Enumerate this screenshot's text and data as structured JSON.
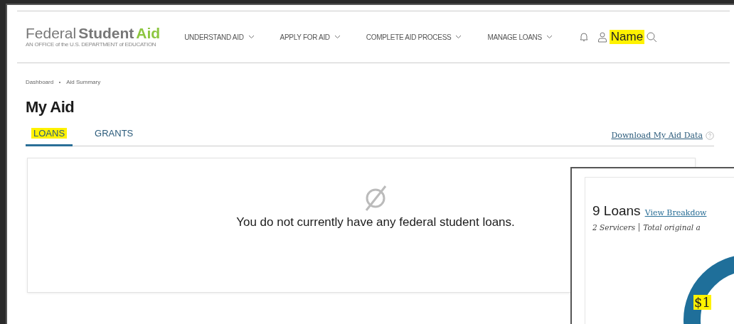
{
  "header": {
    "logo": {
      "word_1": "Federal",
      "word_2": "Student",
      "word_3": "Aid",
      "tagline": "AN OFFICE of the U.S. DEPARTMENT of EDUCATION"
    },
    "nav": [
      {
        "label": "UNDERSTAND AID"
      },
      {
        "label": "APPLY FOR AID"
      },
      {
        "label": "COMPLETE AID PROCESS"
      },
      {
        "label": "MANAGE LOANS"
      }
    ],
    "user": {
      "name": "Name",
      "highlighted": true
    }
  },
  "breadcrumb": [
    "Dashboard",
    "Aid Summary"
  ],
  "title": "My Aid",
  "tabs": [
    {
      "label": "LOANS",
      "selected": true,
      "highlighted": true
    },
    {
      "label": "GRANTS",
      "selected": false,
      "highlighted": false
    }
  ],
  "download_link": "Download My Aid Data",
  "empty_message": "You do not currently have any federal student loans.",
  "inset": {
    "count": "9 Loans",
    "link": "View Breakdow",
    "servicers": "2 Servicers",
    "summary": "Total original a",
    "amount": "$1",
    "amount_highlighted": true
  }
}
